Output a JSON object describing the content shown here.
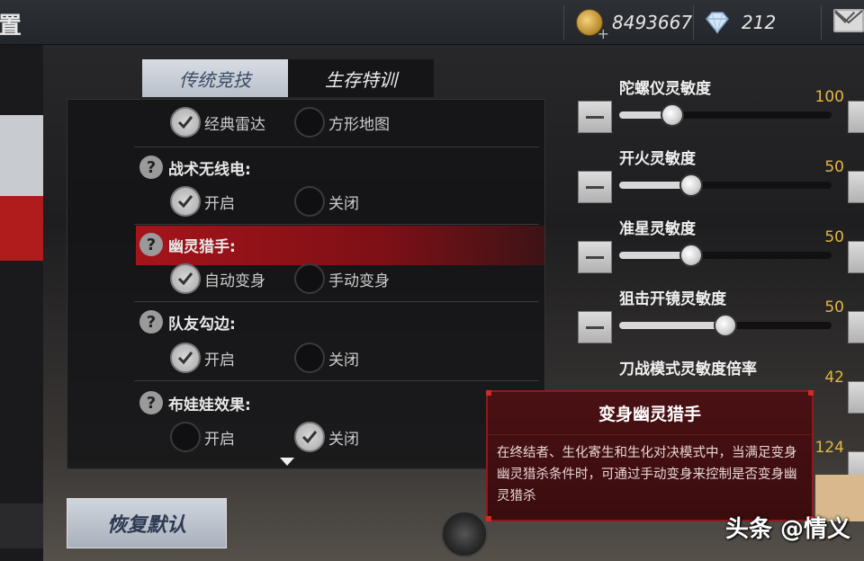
{
  "header": {
    "title_fragment": "置",
    "coins": "8493667",
    "diamonds": "212"
  },
  "tabs": [
    {
      "label": "传统竞技",
      "active": true
    },
    {
      "label": "生存特训",
      "active": false
    }
  ],
  "settings": {
    "radar": {
      "options": [
        "经典雷达",
        "方形地图"
      ],
      "selected": 0
    },
    "tactical_radio": {
      "label": "战术无线电:",
      "options": [
        "开启",
        "关闭"
      ],
      "selected": 0
    },
    "ghost_hunter": {
      "label": "幽灵猎手:",
      "options": [
        "自动变身",
        "手动变身"
      ],
      "selected": 0
    },
    "teammate_outline": {
      "label": "队友勾边:",
      "options": [
        "开启",
        "关闭"
      ],
      "selected": 0
    },
    "ragdoll": {
      "label": "布娃娃效果:",
      "options": [
        "开启",
        "关闭"
      ],
      "selected": 1
    }
  },
  "sliders": [
    {
      "label": "陀螺仪灵敏度",
      "value": "100",
      "fraction": 0.25
    },
    {
      "label": "开火灵敏度",
      "value": "50",
      "fraction": 0.34
    },
    {
      "label": "准星灵敏度",
      "value": "50",
      "fraction": 0.34
    },
    {
      "label": "狙击开镜灵敏度",
      "value": "50",
      "fraction": 0.5
    },
    {
      "label": "刀战模式灵敏度倍率",
      "value": "42",
      "fraction": 0.42
    },
    {
      "label": "",
      "value": "124",
      "fraction": 0.6
    }
  ],
  "restore_label": "恢复默认",
  "tooltip": {
    "title": "变身幽灵猎手",
    "body": "在终结者、生化寄生和生化对决模式中，当满足变身幽灵猎杀条件时，可通过手动变身来控制是否变身幽灵猎杀"
  },
  "watermark": "头条 @情义",
  "colors": {
    "accent_red": "#a4141a",
    "value_gold": "#e2b744"
  }
}
